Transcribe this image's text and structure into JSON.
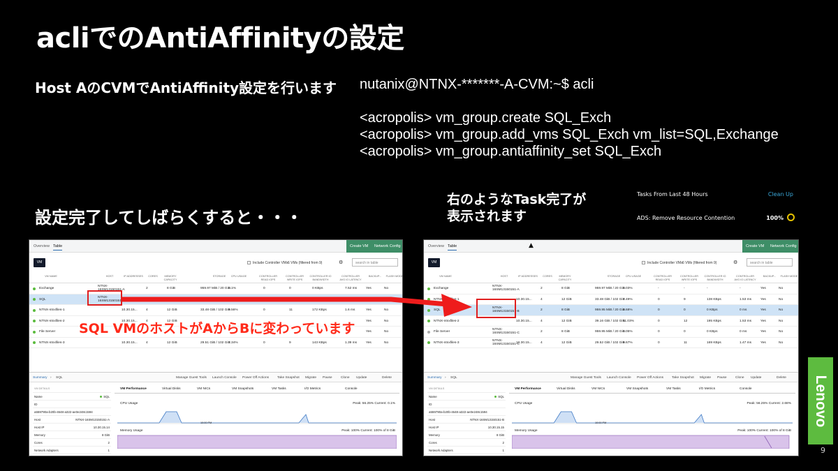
{
  "slide": {
    "title": "acliでのAntiAffinityの設定",
    "subtitle": "Host AのCVMでAntiAffinity設定を行います",
    "commands": [
      "nutanix@NTNX-*******-A-CVM:~$ acli",
      "<acropolis> vm_group.create SQL_Exch",
      "<acropolis> vm_group.add_vms SQL_Exch vm_list=SQL,Exchange",
      "<acropolis> vm_group.antiaffinity_set SQL_Exch"
    ],
    "callout": "設定完了してしばらくすると・・・",
    "task_note_line1": "右のようなTask完了が",
    "task_note_line2": "表示されます",
    "overlay_text": "SQL VMのホストがAからBに変わっています",
    "page_number": "9",
    "logo_text": "Lenovo",
    "colors": {
      "accent_green": "#5dbb3f",
      "highlight_red": "#e01f1f",
      "nav_green": "#3e8e67"
    }
  },
  "tasks_panel": {
    "header": "Tasks From Last 48 Hours",
    "clean_up": "Clean Up",
    "item": "ADS: Remove Resource Contention",
    "progress": "100%"
  },
  "screens": {
    "left": {
      "tabs": [
        "Overview",
        "Table"
      ],
      "actions": [
        "Create VM",
        "Network Config"
      ],
      "vm_button": "VM",
      "include_cvm": "Include Controller VMs",
      "count": "6 VMs (filtered from 9)",
      "search_placeholder": "search in table",
      "columns": [
        "VM NAME",
        "HOST",
        "IP ADDRESSES",
        "CORES",
        "MEMORY CAPACITY",
        "STORAGE",
        "CPU USAGE",
        "CONTROLLER READ IOPS",
        "CONTROLLER WRITE IOPS",
        "CONTROLLER IO BANDWIDTH",
        "CONTROLLER AVG IO LATENCY",
        "BACKUP...",
        "FLASH MODE"
      ],
      "rows": [
        {
          "name": "Exchange",
          "host1": "NTNX-",
          "host2": "16SM13150151-A",
          "ip": "",
          "cores": "2",
          "mem": "8 GiB",
          "storage": "959.97 MiB / 20 GiB",
          "cpu": "0.1%",
          "rio": "0",
          "wio": "0",
          "bw": "0 KBps",
          "lat": "7.52 ms",
          "bk": "Yes",
          "fl": "No",
          "on": true
        },
        {
          "name": "SQL",
          "host1": "NTNX-",
          "host2": "16SM13150151-A",
          "ip": "",
          "cores": "",
          "mem": "",
          "storage": "",
          "cpu": "",
          "rio": "",
          "wio": "",
          "bw": "0 KBps",
          "lat": "0 ms",
          "bk": "Yes",
          "fl": "No",
          "on": true
        },
        {
          "name": "NTNX-ntnxfiles-1",
          "host1": "",
          "host2": "",
          "ip": "10.30.15...",
          "cores": "4",
          "mem": "12 GiB",
          "storage": "33.48 GiB / 102 GiB",
          "cpu": "9.56%",
          "rio": "0",
          "wio": "11",
          "bw": "172 KBps",
          "lat": "1.6 ms",
          "bk": "Yes",
          "fl": "No",
          "on": true
        },
        {
          "name": "NTNX-ntnxfiles-2",
          "host1": "",
          "host2": "",
          "ip": "10.30.15...",
          "cores": "4",
          "mem": "12 GiB",
          "storage": "",
          "cpu": "",
          "rio": "",
          "wio": "",
          "bw": "",
          "lat": "",
          "bk": "Yes",
          "fl": "No",
          "on": true
        },
        {
          "name": "File Server",
          "host1": "",
          "host2": "",
          "ip": "",
          "cores": "",
          "mem": "",
          "storage": "",
          "cpu": "",
          "rio": "",
          "wio": "",
          "bw": "",
          "lat": "",
          "bk": "Yes",
          "fl": "No",
          "on": true
        },
        {
          "name": "NTNX-ntnxfiles-3",
          "host1": "",
          "host2": "",
          "ip": "10.30.15...",
          "cores": "4",
          "mem": "12 GiB",
          "storage": "29.51 GiB / 102 GiB",
          "cpu": "7.34%",
          "rio": "0",
          "wio": "9",
          "bw": "143 KBps",
          "lat": "1.39 ms",
          "bk": "Yes",
          "fl": "No",
          "on": true
        }
      ],
      "summary": {
        "crumb": "Summary",
        "vm": "SQL",
        "actions": [
          "Manage Guest Tools",
          "Launch Console",
          "Power Off Actions",
          "Take Snapshot",
          "Migrate",
          "Pause",
          "Clone",
          "Update",
          "Delete"
        ]
      },
      "details": [
        {
          "k": "VM DETAILS",
          "v": ""
        },
        {
          "k": "Name",
          "v": "SQL"
        },
        {
          "k": "ID",
          "v": ""
        },
        {
          "k": "",
          "v": "a559790a-b20b-4648-a322-ae0e248c1594"
        },
        {
          "k": "Host",
          "v": "NTNX-16SM13150151-A"
        },
        {
          "k": "Host IP",
          "v": "10.30.15.14"
        },
        {
          "k": "Memory",
          "v": "8 GiB"
        },
        {
          "k": "Cores",
          "v": "2"
        },
        {
          "k": "Network Adapters",
          "v": "1"
        }
      ],
      "panel_tabs": [
        "VM Performance",
        "Virtual Disks",
        "VM NICs",
        "VM Snapshots",
        "VM Tasks",
        "I/O Metrics",
        "Console"
      ],
      "cpu_label": "CPU Usage",
      "cpu_peak": "Peak: 56.25%  Current: 0.1%",
      "mem_label": "Memory Usage",
      "mem_peak": "Peak: 100%  Current: 100% of 8 GiB",
      "time_label": "10:00 PM"
    },
    "right": {
      "tabs": [
        "Overview",
        "Table"
      ],
      "actions": [
        "Create VM",
        "Network Config"
      ],
      "vm_button": "VM",
      "include_cvm": "Include Controller VMs",
      "count": "6 VMs (filtered from 9)",
      "search_placeholder": "search in table",
      "columns": [
        "VM NAME",
        "HOST",
        "IP ADDRESSES",
        "CORES",
        "MEMORY CAPACITY",
        "STORAGE",
        "CPU USAGE",
        "CONTROLLER READ IOPS",
        "CONTROLLER WRITE IOPS",
        "CONTROLLER IO BANDWIDTH",
        "CONTROLLER AVG IO LATENCY",
        "BACKUP...",
        "FLASH MODE"
      ],
      "rows": [
        {
          "name": "Exchange",
          "host1": "NTNX-",
          "host2": "16SM13150151-A",
          "ip": "",
          "cores": "2",
          "mem": "8 GiB",
          "storage": "959.97 MiB / 20 GiB",
          "cpu": "0.03%",
          "rio": "-",
          "wio": "-",
          "bw": "-",
          "lat": "-",
          "bk": "Yes",
          "fl": "No",
          "on": true
        },
        {
          "name": "NTNX-ntnxfiles-1",
          "host1": "",
          "host2": "",
          "ip": "10.30.15...",
          "cores": "4",
          "mem": "12 GiB",
          "storage": "33.48 GiB / 102 GiB",
          "cpu": "7.49%",
          "rio": "0",
          "wio": "9",
          "bw": "138 KBps",
          "lat": "1.53 ms",
          "bk": "Yes",
          "fl": "No",
          "on": true
        },
        {
          "name": "SQL",
          "host1": "NTNX-",
          "host2": "16SM13150151-B",
          "ip": "",
          "cores": "2",
          "mem": "8 GiB",
          "storage": "959.95 MiB / 20 GiB",
          "cpu": "2.68%",
          "rio": "0",
          "wio": "0",
          "bw": "0 KBps",
          "lat": "0 ms",
          "bk": "Yes",
          "fl": "No",
          "on": true
        },
        {
          "name": "NTNX-ntnxfiles-2",
          "host1": "",
          "host2": "",
          "ip": "10.30.15...",
          "cores": "4",
          "mem": "12 GiB",
          "storage": "39.16 GiB / 102 GiB",
          "cpu": "11.03%",
          "rio": "0",
          "wio": "12",
          "bw": "195 KBps",
          "lat": "1.53 ms",
          "bk": "Yes",
          "fl": "No",
          "on": true
        },
        {
          "name": "File Server",
          "host1": "NTNX-",
          "host2": "16SM13150151-C",
          "ip": "",
          "cores": "2",
          "mem": "8 GiB",
          "storage": "959.95 MiB / 20 GiB",
          "cpu": "0.05%",
          "rio": "0",
          "wio": "0",
          "bw": "0 KBps",
          "lat": "0 ms",
          "bk": "Yes",
          "fl": "No",
          "on": false
        },
        {
          "name": "NTNX-ntnxfiles-3",
          "host1": "NTNX-",
          "host2": "16SM13150151-C",
          "ip": "10.30.15...",
          "cores": "4",
          "mem": "12 GiB",
          "storage": "29.52 GiB / 102 GiB",
          "cpu": "9.67%",
          "rio": "0",
          "wio": "11",
          "bw": "169 KBps",
          "lat": "1.47 ms",
          "bk": "Yes",
          "fl": "No",
          "on": true
        }
      ],
      "summary": {
        "crumb": "Summary",
        "vm": "SQL",
        "actions": [
          "Manage Guest Tools",
          "Launch Console",
          "Power Off Actions",
          "Take Snapshot",
          "Migrate",
          "Pause",
          "Clone",
          "Update",
          "Delete"
        ]
      },
      "details": [
        {
          "k": "VM DETAILS",
          "v": ""
        },
        {
          "k": "Name",
          "v": "SQL"
        },
        {
          "k": "ID",
          "v": ""
        },
        {
          "k": "",
          "v": "a559790a-b20b-4648-a322-ae0e248c1594"
        },
        {
          "k": "Host",
          "v": "NTNX-16SM13150151-B"
        },
        {
          "k": "Host IP",
          "v": "10.30.15.15"
        },
        {
          "k": "Memory",
          "v": "8 GiB"
        },
        {
          "k": "Cores",
          "v": "2"
        },
        {
          "k": "Network Adapters",
          "v": "1"
        }
      ],
      "panel_tabs": [
        "VM Performance",
        "Virtual Disks",
        "VM NICs",
        "VM Snapshots",
        "VM Tasks",
        "I/O Metrics",
        "Console"
      ],
      "cpu_label": "CPU Usage",
      "cpu_peak": "Peak: 56.25%  Current: 2.68%",
      "mem_label": "Memory Usage",
      "mem_peak": "Peak: 100%  Current: 100% of 8 GiB",
      "time_label": "10:00 PM"
    }
  }
}
